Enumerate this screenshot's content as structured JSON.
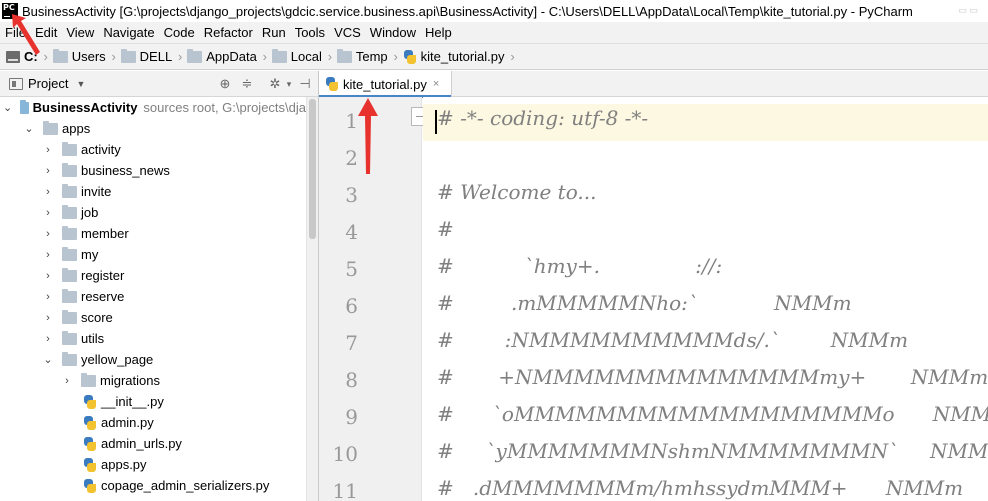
{
  "titlebar": {
    "logo_text": "PC",
    "title": "BusinessActivity [G:\\projects\\django_projects\\gdcic.service.business.api\\BusinessActivity] - C:\\Users\\DELL\\AppData\\Local\\Temp\\kite_tutorial.py - PyCharm"
  },
  "menubar": {
    "items": [
      {
        "label": "File"
      },
      {
        "label": "Edit"
      },
      {
        "label": "View"
      },
      {
        "label": "Navigate"
      },
      {
        "label": "Code"
      },
      {
        "label": "Refactor"
      },
      {
        "label": "Run"
      },
      {
        "label": "Tools"
      },
      {
        "label": "VCS"
      },
      {
        "label": "Window"
      },
      {
        "label": "Help"
      }
    ]
  },
  "breadcrumb": {
    "items": [
      {
        "label": "C:",
        "icon": "drive-icon"
      },
      {
        "label": "Users",
        "icon": "folder-icon"
      },
      {
        "label": "DELL",
        "icon": "folder-icon"
      },
      {
        "label": "AppData",
        "icon": "folder-icon"
      },
      {
        "label": "Local",
        "icon": "folder-icon"
      },
      {
        "label": "Temp",
        "icon": "folder-icon"
      },
      {
        "label": "kite_tutorial.py",
        "icon": "python-file-icon"
      }
    ]
  },
  "project_panel": {
    "title": "Project",
    "tree": [
      {
        "label": "BusinessActivity",
        "sub": "sources root, G:\\projects\\dja",
        "depth": 0,
        "expanded": true,
        "kind": "root"
      },
      {
        "label": "apps",
        "depth": 1,
        "expanded": true,
        "kind": "folder"
      },
      {
        "label": "activity",
        "depth": 2,
        "expanded": false,
        "kind": "folder"
      },
      {
        "label": "business_news",
        "depth": 2,
        "expanded": false,
        "kind": "folder"
      },
      {
        "label": "invite",
        "depth": 2,
        "expanded": false,
        "kind": "folder"
      },
      {
        "label": "job",
        "depth": 2,
        "expanded": false,
        "kind": "folder"
      },
      {
        "label": "member",
        "depth": 2,
        "expanded": false,
        "kind": "folder"
      },
      {
        "label": "my",
        "depth": 2,
        "expanded": false,
        "kind": "folder"
      },
      {
        "label": "register",
        "depth": 2,
        "expanded": false,
        "kind": "folder"
      },
      {
        "label": "reserve",
        "depth": 2,
        "expanded": false,
        "kind": "folder"
      },
      {
        "label": "score",
        "depth": 2,
        "expanded": false,
        "kind": "folder"
      },
      {
        "label": "utils",
        "depth": 2,
        "expanded": false,
        "kind": "folder"
      },
      {
        "label": "yellow_page",
        "depth": 2,
        "expanded": true,
        "kind": "folder"
      },
      {
        "label": "migrations",
        "depth": 3,
        "expanded": false,
        "kind": "folder"
      },
      {
        "label": "__init__.py",
        "depth": 3,
        "kind": "py"
      },
      {
        "label": "admin.py",
        "depth": 3,
        "kind": "py"
      },
      {
        "label": "admin_urls.py",
        "depth": 3,
        "kind": "py"
      },
      {
        "label": "apps.py",
        "depth": 3,
        "kind": "py"
      },
      {
        "label": "copage_admin_serializers.py",
        "depth": 3,
        "kind": "py"
      }
    ]
  },
  "editor": {
    "tab": {
      "label": "kite_tutorial.py",
      "close": "×"
    },
    "lines": [
      {
        "num": "1",
        "text": "# -*- coding: utf-8 -*-"
      },
      {
        "num": "2",
        "text": ""
      },
      {
        "num": "3",
        "text": "# Welcome to..."
      },
      {
        "num": "4",
        "text": "#"
      },
      {
        "num": "5",
        "text": "#           `hmy+.               ://:"
      },
      {
        "num": "6",
        "text": "#         .mMMMMMNho:`            NMMm"
      },
      {
        "num": "7",
        "text": "#        :NMMMMMMMMMMds/.`        NMMm"
      },
      {
        "num": "8",
        "text": "#       +NMMMMMMMMMMMMMMmy+       NMMm"
      },
      {
        "num": "9",
        "text": "#      `oMMMMMMMMMMMMMMMMMMo      NMMm"
      },
      {
        "num": "10",
        "text": "#     `yMMMMMMMNshmNMMMMMMMN`     NMMm"
      },
      {
        "num": "11",
        "text": "#   .dMMMMMMMm/hmhssydmMMM+      NMMm    `/yh"
      }
    ]
  },
  "colors": {
    "accent": "#4a86c7",
    "annotation_red": "#e8322e",
    "caret_line": "#fdf8e1",
    "comment": "#808080"
  }
}
